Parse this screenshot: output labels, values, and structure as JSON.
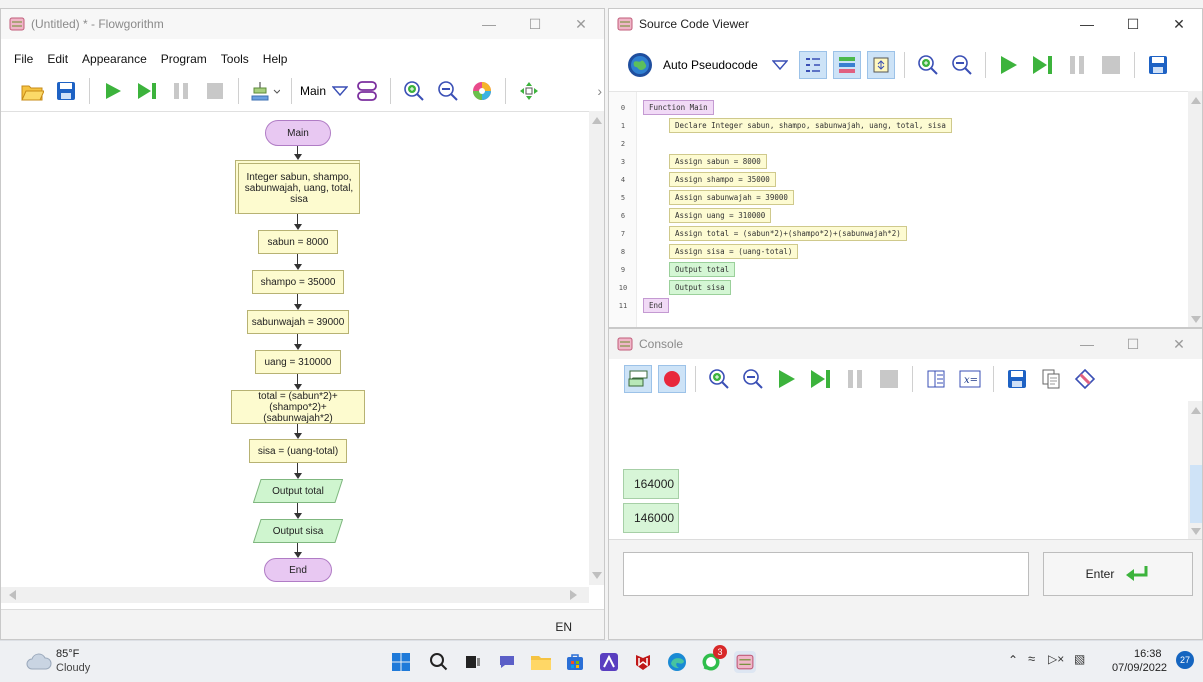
{
  "flowgorithm": {
    "title": "(Untitled) * - Flowgorithm",
    "menu": [
      "File",
      "Edit",
      "Appearance",
      "Program",
      "Tools",
      "Help"
    ],
    "function_selector": "Main",
    "status_lang": "EN",
    "flowchart": {
      "start": "Main",
      "declare": "Integer sabun, shampo, sabunwajah, uang, total, sisa",
      "assign_sabun": "sabun = 8000",
      "assign_shampo": "shampo = 35000",
      "assign_sabunwajah": "sabunwajah = 39000",
      "assign_uang": "uang = 310000",
      "assign_total": "total = (sabun*2)+(shampo*2)+(sabunwajah*2)",
      "assign_sisa": "sisa = (uang-total)",
      "output_total": "Output total",
      "output_sisa": "Output sisa",
      "end": "End"
    }
  },
  "source_viewer": {
    "title": "Source Code Viewer",
    "language": "Auto Pseudocode",
    "line_numbers": [
      "0",
      "1",
      "2",
      "3",
      "4",
      "5",
      "6",
      "7",
      "8",
      "9",
      "10",
      "11"
    ],
    "lines": {
      "l0": "Function Main",
      "l1": "Declare Integer sabun, shampo, sabunwajah, uang, total, sisa",
      "l3": "Assign sabun = 8000",
      "l4": "Assign shampo = 35000",
      "l5": "Assign sabunwajah = 39000",
      "l6": "Assign uang = 310000",
      "l7": "Assign total = (sabun*2)+(shampo*2)+(sabunwajah*2)",
      "l8": "Assign sisa = (uang-total)",
      "l9": "Output total",
      "l10": "Output sisa",
      "l11": "End"
    }
  },
  "console": {
    "title": "Console",
    "outputs": [
      "164000",
      "146000"
    ],
    "input_value": "",
    "enter_label": "Enter"
  },
  "taskbar": {
    "weather_temp": "85°F",
    "weather_desc": "Cloudy",
    "time": "16:38",
    "date": "07/09/2022",
    "notifications": "27",
    "whatsapp_badge": "3"
  },
  "colors": {
    "terminal": "#e8c8f2",
    "process": "#fdfbcf",
    "io": "#cff5cf",
    "accent": "#0067c0"
  }
}
